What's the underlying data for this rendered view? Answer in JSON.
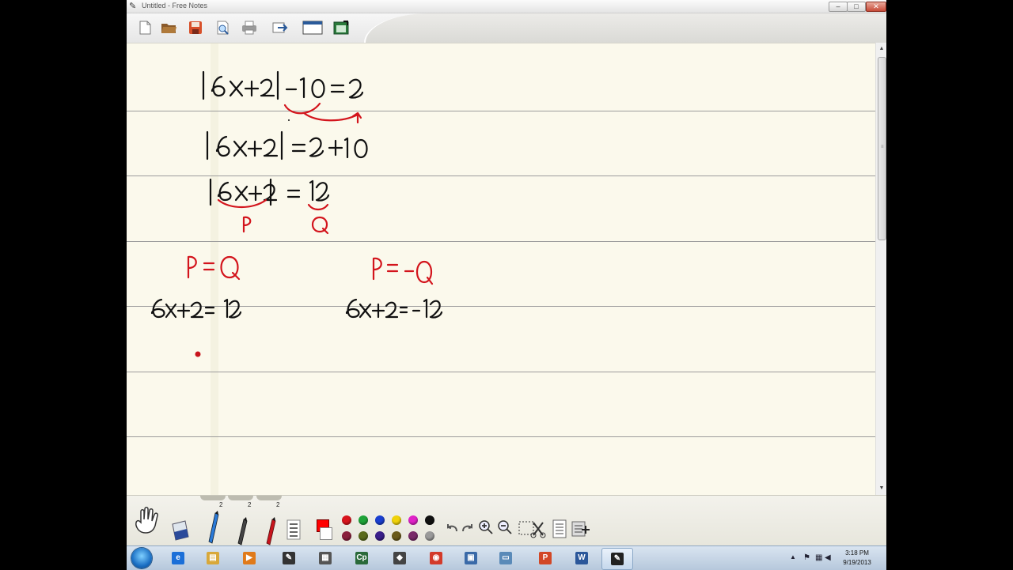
{
  "window": {
    "title": "Untitled - Free Notes"
  },
  "titlebar": {
    "minimize_glyph": "–",
    "maximize_glyph": "□",
    "close_glyph": "✕"
  },
  "toolbar": {
    "items": [
      "new-page-icon",
      "open-folder-icon",
      "save-icon",
      "print-preview-icon",
      "print-icon",
      "export-icon",
      "window-icon",
      "screenshot-icon"
    ]
  },
  "bottom_tools": {
    "pen_sizes": [
      "2",
      "2",
      "2"
    ],
    "palette_top": [
      "#d8141c",
      "#1ea338",
      "#1a3fd0",
      "#f0d20a",
      "#e022c8",
      "#111111"
    ],
    "palette_bottom": [
      "#8a1f3c",
      "#5a6a1a",
      "#3a1f8a",
      "#6a5a1a",
      "#7a2a6a",
      "#9a9a9a"
    ],
    "current_color": "#ff0000"
  },
  "scrollbar": {
    "up_glyph": "▲",
    "down_glyph": "▼",
    "grip_glyph": "≡"
  },
  "taskbar": {
    "time": "3:18 PM",
    "date": "9/19/2013",
    "tray_arrow": "▲",
    "apps": [
      {
        "icon": "internet-explorer-icon",
        "glyph": "e",
        "color": "#1b6fd8"
      },
      {
        "icon": "file-explorer-icon",
        "glyph": "▤",
        "color": "#d8a83a"
      },
      {
        "icon": "media-player-icon",
        "glyph": "▶",
        "color": "#e07a1a"
      },
      {
        "icon": "free-notes-icon",
        "glyph": "✎",
        "color": "#333333"
      },
      {
        "icon": "scanner-icon",
        "glyph": "▦",
        "color": "#555555"
      },
      {
        "icon": "captivate-icon",
        "glyph": "Cp",
        "color": "#2a6a3a"
      },
      {
        "icon": "projector-icon",
        "glyph": "◆",
        "color": "#444444"
      },
      {
        "icon": "chrome-icon",
        "glyph": "◉",
        "color": "#d33a2a"
      },
      {
        "icon": "network-icon",
        "glyph": "▣",
        "color": "#3a6aa8"
      },
      {
        "icon": "notepad-icon",
        "glyph": "▭",
        "color": "#5a8ab8"
      },
      {
        "icon": "powerpoint-icon",
        "glyph": "P",
        "color": "#d24726"
      },
      {
        "icon": "word-icon",
        "glyph": "W",
        "color": "#2b579a"
      },
      {
        "icon": "free-notes-active-icon",
        "glyph": "✎",
        "color": "#222222"
      }
    ]
  }
}
